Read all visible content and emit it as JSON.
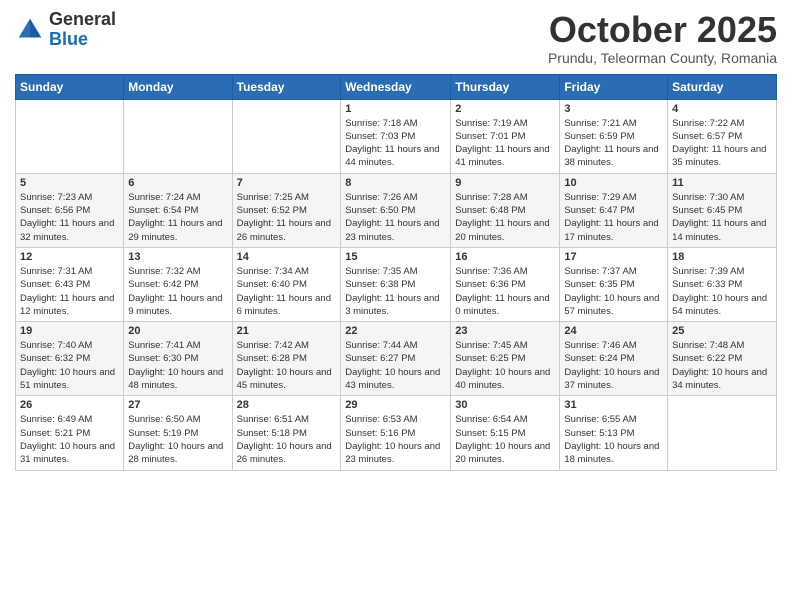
{
  "logo": {
    "general": "General",
    "blue": "Blue"
  },
  "header": {
    "month": "October 2025",
    "location": "Prundu, Teleorman County, Romania"
  },
  "days_of_week": [
    "Sunday",
    "Monday",
    "Tuesday",
    "Wednesday",
    "Thursday",
    "Friday",
    "Saturday"
  ],
  "weeks": [
    [
      {
        "day": "",
        "info": ""
      },
      {
        "day": "",
        "info": ""
      },
      {
        "day": "",
        "info": ""
      },
      {
        "day": "1",
        "info": "Sunrise: 7:18 AM\nSunset: 7:03 PM\nDaylight: 11 hours and 44 minutes."
      },
      {
        "day": "2",
        "info": "Sunrise: 7:19 AM\nSunset: 7:01 PM\nDaylight: 11 hours and 41 minutes."
      },
      {
        "day": "3",
        "info": "Sunrise: 7:21 AM\nSunset: 6:59 PM\nDaylight: 11 hours and 38 minutes."
      },
      {
        "day": "4",
        "info": "Sunrise: 7:22 AM\nSunset: 6:57 PM\nDaylight: 11 hours and 35 minutes."
      }
    ],
    [
      {
        "day": "5",
        "info": "Sunrise: 7:23 AM\nSunset: 6:56 PM\nDaylight: 11 hours and 32 minutes."
      },
      {
        "day": "6",
        "info": "Sunrise: 7:24 AM\nSunset: 6:54 PM\nDaylight: 11 hours and 29 minutes."
      },
      {
        "day": "7",
        "info": "Sunrise: 7:25 AM\nSunset: 6:52 PM\nDaylight: 11 hours and 26 minutes."
      },
      {
        "day": "8",
        "info": "Sunrise: 7:26 AM\nSunset: 6:50 PM\nDaylight: 11 hours and 23 minutes."
      },
      {
        "day": "9",
        "info": "Sunrise: 7:28 AM\nSunset: 6:48 PM\nDaylight: 11 hours and 20 minutes."
      },
      {
        "day": "10",
        "info": "Sunrise: 7:29 AM\nSunset: 6:47 PM\nDaylight: 11 hours and 17 minutes."
      },
      {
        "day": "11",
        "info": "Sunrise: 7:30 AM\nSunset: 6:45 PM\nDaylight: 11 hours and 14 minutes."
      }
    ],
    [
      {
        "day": "12",
        "info": "Sunrise: 7:31 AM\nSunset: 6:43 PM\nDaylight: 11 hours and 12 minutes."
      },
      {
        "day": "13",
        "info": "Sunrise: 7:32 AM\nSunset: 6:42 PM\nDaylight: 11 hours and 9 minutes."
      },
      {
        "day": "14",
        "info": "Sunrise: 7:34 AM\nSunset: 6:40 PM\nDaylight: 11 hours and 6 minutes."
      },
      {
        "day": "15",
        "info": "Sunrise: 7:35 AM\nSunset: 6:38 PM\nDaylight: 11 hours and 3 minutes."
      },
      {
        "day": "16",
        "info": "Sunrise: 7:36 AM\nSunset: 6:36 PM\nDaylight: 11 hours and 0 minutes."
      },
      {
        "day": "17",
        "info": "Sunrise: 7:37 AM\nSunset: 6:35 PM\nDaylight: 10 hours and 57 minutes."
      },
      {
        "day": "18",
        "info": "Sunrise: 7:39 AM\nSunset: 6:33 PM\nDaylight: 10 hours and 54 minutes."
      }
    ],
    [
      {
        "day": "19",
        "info": "Sunrise: 7:40 AM\nSunset: 6:32 PM\nDaylight: 10 hours and 51 minutes."
      },
      {
        "day": "20",
        "info": "Sunrise: 7:41 AM\nSunset: 6:30 PM\nDaylight: 10 hours and 48 minutes."
      },
      {
        "day": "21",
        "info": "Sunrise: 7:42 AM\nSunset: 6:28 PM\nDaylight: 10 hours and 45 minutes."
      },
      {
        "day": "22",
        "info": "Sunrise: 7:44 AM\nSunset: 6:27 PM\nDaylight: 10 hours and 43 minutes."
      },
      {
        "day": "23",
        "info": "Sunrise: 7:45 AM\nSunset: 6:25 PM\nDaylight: 10 hours and 40 minutes."
      },
      {
        "day": "24",
        "info": "Sunrise: 7:46 AM\nSunset: 6:24 PM\nDaylight: 10 hours and 37 minutes."
      },
      {
        "day": "25",
        "info": "Sunrise: 7:48 AM\nSunset: 6:22 PM\nDaylight: 10 hours and 34 minutes."
      }
    ],
    [
      {
        "day": "26",
        "info": "Sunrise: 6:49 AM\nSunset: 5:21 PM\nDaylight: 10 hours and 31 minutes."
      },
      {
        "day": "27",
        "info": "Sunrise: 6:50 AM\nSunset: 5:19 PM\nDaylight: 10 hours and 28 minutes."
      },
      {
        "day": "28",
        "info": "Sunrise: 6:51 AM\nSunset: 5:18 PM\nDaylight: 10 hours and 26 minutes."
      },
      {
        "day": "29",
        "info": "Sunrise: 6:53 AM\nSunset: 5:16 PM\nDaylight: 10 hours and 23 minutes."
      },
      {
        "day": "30",
        "info": "Sunrise: 6:54 AM\nSunset: 5:15 PM\nDaylight: 10 hours and 20 minutes."
      },
      {
        "day": "31",
        "info": "Sunrise: 6:55 AM\nSunset: 5:13 PM\nDaylight: 10 hours and 18 minutes."
      },
      {
        "day": "",
        "info": ""
      }
    ]
  ]
}
